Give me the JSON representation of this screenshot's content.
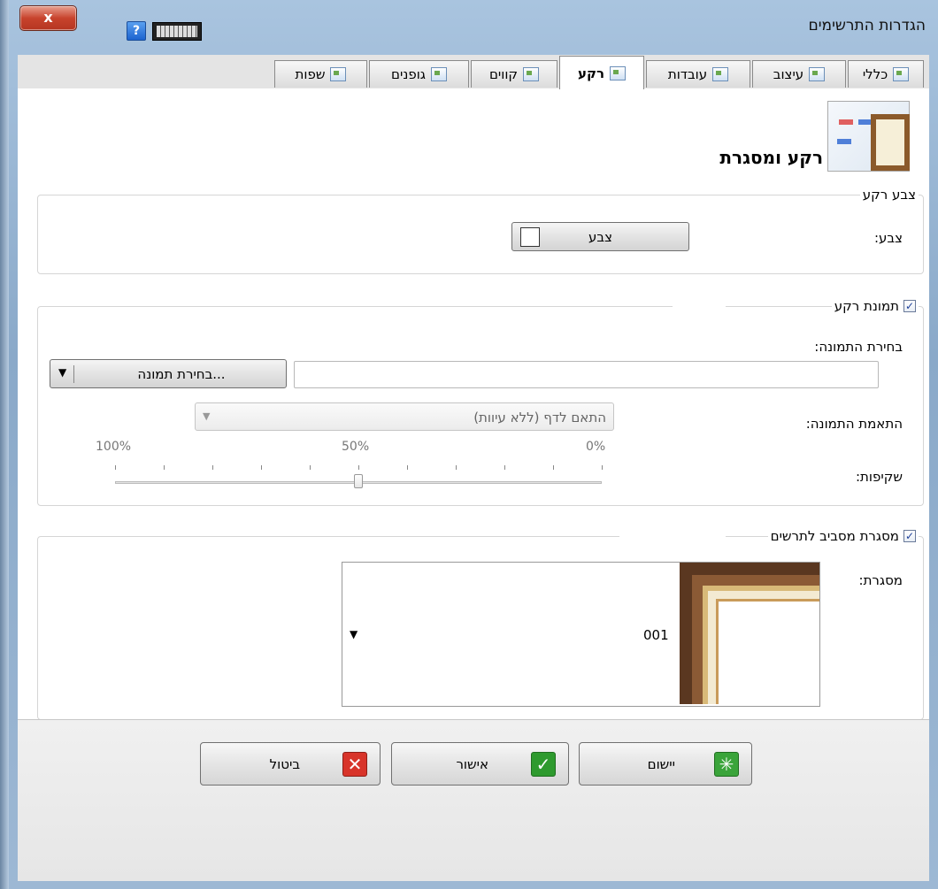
{
  "window": {
    "title": "הגדרות התרשימים",
    "close_label": "x",
    "help_label": "?"
  },
  "tabs": [
    {
      "label": "כללי",
      "icon": "general-settings-icon"
    },
    {
      "label": "עיצוב",
      "icon": "design-icon"
    },
    {
      "label": "עובדות",
      "icon": "facts-icon"
    },
    {
      "label": "רקע",
      "icon": "background-icon",
      "active": true
    },
    {
      "label": "קווים",
      "icon": "lines-icon"
    },
    {
      "label": "גופנים",
      "icon": "fonts-icon"
    },
    {
      "label": "שפות",
      "icon": "languages-icon"
    }
  ],
  "section_title": "רקע ומסגרת",
  "bg_color": {
    "group_label": "צבע רקע",
    "color_label": "צבע:",
    "color_button": "צבע",
    "swatch_color": "#ffffff"
  },
  "bg_image": {
    "group_label": "תמונת רקע",
    "checked": true,
    "choose_label": "בחירת התמונה:",
    "path_value": "",
    "choose_button": "בחירת תמונה...",
    "fit_label": "התאמת התמונה:",
    "fit_value": "התאם לדף (ללא עיוות)",
    "transparency_label": "שקיפות:",
    "scale_labels": [
      "0%",
      "50%",
      "100%"
    ],
    "transparency_percent": 50
  },
  "frame": {
    "group_label": "מסגרת מסביב לתרשים",
    "checked": true,
    "frame_label": "מסגרת:",
    "frame_value": "001"
  },
  "buttons": {
    "apply": "יישום",
    "ok": "אישור",
    "cancel": "ביטול"
  },
  "colors": {
    "apply_icon": "#3aa43a",
    "ok_icon": "#2e9a2e",
    "cancel_icon": "#d8342a"
  }
}
